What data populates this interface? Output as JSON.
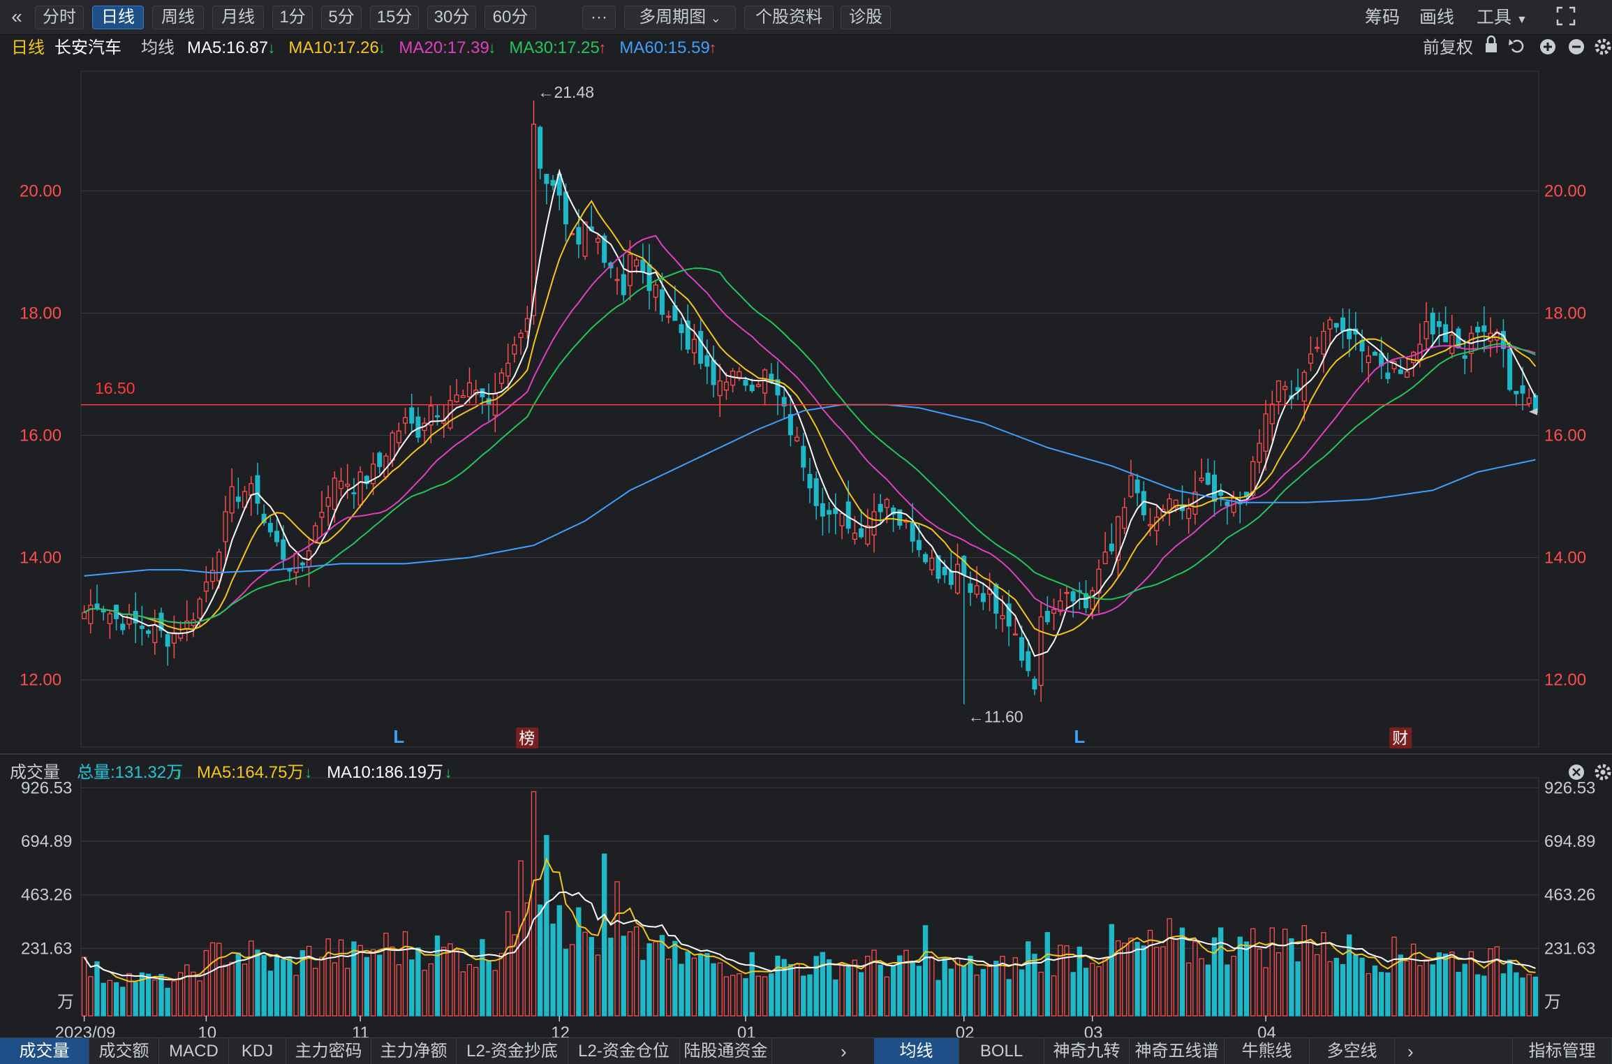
{
  "toolbar": {
    "back_icon": "double-chevron-left-icon",
    "periods": [
      "分时",
      "日线",
      "周线",
      "月线",
      "1分",
      "5分",
      "15分",
      "30分",
      "60分"
    ],
    "active_period": "日线",
    "more_label": "···",
    "multi_period": "多周期图",
    "stock_info": "个股资料",
    "diagnose": "诊股",
    "right_items": [
      "筹码",
      "画线",
      "工具"
    ],
    "fullscreen_icon": "fullscreen-icon"
  },
  "price_header": {
    "period": "日线",
    "stock_name": "长安汽车",
    "ma_label": "均线",
    "indicators": [
      {
        "text": "MA5:16.87",
        "color": "#ffffff",
        "arrow": "down"
      },
      {
        "text": "MA10:17.26",
        "color": "#f5c518",
        "arrow": "down"
      },
      {
        "text": "MA20:17.39",
        "color": "#e040c0",
        "arrow": "down"
      },
      {
        "text": "MA30:17.25",
        "color": "#22c55e",
        "arrow": "up"
      },
      {
        "text": "MA60:15.59",
        "color": "#3ea0ff",
        "arrow": "up"
      }
    ],
    "adjust": "前复权",
    "icons": [
      "lock-icon",
      "undo-icon",
      "zoom-in-icon",
      "zoom-out-icon",
      "settings-icon"
    ]
  },
  "volume_header": {
    "label": "成交量",
    "indicators": [
      {
        "text": "总量:131.32万",
        "color": "#22c5d5",
        "arrow": "down"
      },
      {
        "text": "MA5:164.75万",
        "color": "#f5c518",
        "arrow": "down"
      },
      {
        "text": "MA10:186.19万",
        "color": "#ffffff",
        "arrow": "down"
      }
    ],
    "icons": [
      "close-icon",
      "settings-icon"
    ]
  },
  "colors": {
    "up": "#ff4d4d",
    "down": "#1fb8c9",
    "ma5": "#ffffff",
    "ma10": "#f5c518",
    "ma20": "#e040c0",
    "ma30": "#22c55e",
    "ma60": "#3ea0ff",
    "ref_line": "#ff3b3b",
    "axis_text": "#ff4d4d",
    "grid": "#3a3d43"
  },
  "chart_data": [
    {
      "type": "candlestick",
      "title": "长安汽车 日线",
      "ylim": [
        10.9,
        22.3
      ],
      "y_ticks": [
        "12.00",
        "14.00",
        "16.00",
        "18.00",
        "20.00"
      ],
      "ref_line": {
        "value": 16.5,
        "label": "16.50"
      },
      "annotations": [
        {
          "label": "←21.48",
          "index": 70,
          "value": 21.48
        },
        {
          "label": "←11.60",
          "index": 137,
          "value": 11.6
        }
      ],
      "markers": [
        {
          "label": "L",
          "index": 49,
          "boxed": false
        },
        {
          "label": "榜",
          "index": 69,
          "boxed": true
        },
        {
          "label": "L",
          "index": 155,
          "boxed": false
        },
        {
          "label": "财",
          "index": 205,
          "boxed": true
        }
      ],
      "anchors": {
        "close": [
          [
            0,
            13.1
          ],
          [
            2,
            13.3
          ],
          [
            5,
            13.0
          ],
          [
            8,
            12.9
          ],
          [
            11,
            12.8
          ],
          [
            13,
            12.7
          ],
          [
            15,
            12.85
          ],
          [
            16,
            12.9
          ],
          [
            18,
            13.3
          ],
          [
            20,
            13.9
          ],
          [
            22,
            14.6
          ],
          [
            23,
            15.0
          ],
          [
            25,
            15.1
          ],
          [
            27,
            15.0
          ],
          [
            28,
            14.6
          ],
          [
            30,
            14.2
          ],
          [
            32,
            13.9
          ],
          [
            34,
            13.9
          ],
          [
            36,
            14.5
          ],
          [
            38,
            15.1
          ],
          [
            40,
            15.3
          ],
          [
            42,
            15.2
          ],
          [
            44,
            15.3
          ],
          [
            46,
            15.5
          ],
          [
            48,
            16.0
          ],
          [
            50,
            16.2
          ],
          [
            52,
            16.1
          ],
          [
            54,
            16.5
          ],
          [
            56,
            16.4
          ],
          [
            57,
            16.6
          ],
          [
            59,
            16.6
          ],
          [
            61,
            16.8
          ],
          [
            63,
            16.5
          ],
          [
            65,
            16.9
          ],
          [
            67,
            17.5
          ],
          [
            69,
            18.0
          ],
          [
            70,
            21.0
          ],
          [
            71,
            20.5
          ],
          [
            72,
            20.2
          ],
          [
            74,
            19.8
          ],
          [
            75,
            19.3
          ],
          [
            77,
            19.0
          ],
          [
            78,
            19.4
          ],
          [
            80,
            19.2
          ],
          [
            82,
            18.8
          ],
          [
            84,
            18.4
          ],
          [
            85,
            19.0
          ],
          [
            87,
            18.6
          ],
          [
            89,
            18.3
          ],
          [
            91,
            18.0
          ],
          [
            93,
            17.7
          ],
          [
            95,
            17.4
          ],
          [
            97,
            17.0
          ],
          [
            98,
            16.8
          ],
          [
            100,
            17.0
          ],
          [
            102,
            16.9
          ],
          [
            104,
            16.9
          ],
          [
            106,
            17.0
          ],
          [
            108,
            16.6
          ],
          [
            110,
            16.1
          ],
          [
            112,
            15.6
          ],
          [
            114,
            15.0
          ],
          [
            116,
            14.7
          ],
          [
            117,
            14.6
          ],
          [
            119,
            14.6
          ],
          [
            120,
            14.4
          ],
          [
            122,
            14.6
          ],
          [
            124,
            14.9
          ],
          [
            125,
            15.0
          ],
          [
            127,
            14.6
          ],
          [
            129,
            14.4
          ],
          [
            131,
            14.1
          ],
          [
            133,
            13.8
          ],
          [
            135,
            13.7
          ],
          [
            136,
            13.9
          ],
          [
            138,
            13.6
          ],
          [
            140,
            13.3
          ],
          [
            141,
            13.4
          ],
          [
            143,
            12.9
          ],
          [
            145,
            12.7
          ],
          [
            146,
            12.4
          ],
          [
            147,
            12.2
          ],
          [
            148,
            12.0
          ],
          [
            149,
            12.9
          ],
          [
            151,
            13.3
          ],
          [
            153,
            13.5
          ],
          [
            155,
            13.4
          ],
          [
            156,
            13.2
          ],
          [
            158,
            13.8
          ],
          [
            160,
            14.1
          ],
          [
            161,
            14.7
          ],
          [
            163,
            15.2
          ],
          [
            164,
            15.0
          ],
          [
            166,
            14.4
          ],
          [
            168,
            14.8
          ],
          [
            170,
            14.8
          ],
          [
            172,
            14.8
          ],
          [
            174,
            15.2
          ],
          [
            176,
            14.9
          ],
          [
            178,
            14.8
          ],
          [
            180,
            14.9
          ],
          [
            182,
            15.4
          ],
          [
            184,
            16.3
          ],
          [
            186,
            16.8
          ],
          [
            188,
            16.6
          ],
          [
            190,
            16.9
          ],
          [
            192,
            17.6
          ],
          [
            194,
            17.9
          ],
          [
            195,
            17.6
          ],
          [
            197,
            17.7
          ],
          [
            199,
            17.5
          ],
          [
            201,
            17.3
          ],
          [
            203,
            17.1
          ],
          [
            205,
            17.0
          ],
          [
            207,
            17.4
          ],
          [
            209,
            17.8
          ],
          [
            211,
            17.7
          ],
          [
            213,
            17.5
          ],
          [
            215,
            17.3
          ],
          [
            217,
            17.8
          ],
          [
            219,
            17.7
          ],
          [
            221,
            17.4
          ],
          [
            222,
            16.9
          ],
          [
            224,
            16.7
          ],
          [
            225,
            16.7
          ],
          [
            226,
            16.4
          ]
        ],
        "ma60": [
          [
            0,
            13.7
          ],
          [
            10,
            13.8
          ],
          [
            15,
            13.8
          ],
          [
            20,
            13.75
          ],
          [
            30,
            13.8
          ],
          [
            40,
            13.9
          ],
          [
            50,
            13.9
          ],
          [
            55,
            13.95
          ],
          [
            60,
            14.0
          ],
          [
            70,
            14.2
          ],
          [
            78,
            14.6
          ],
          [
            85,
            15.1
          ],
          [
            95,
            15.6
          ],
          [
            105,
            16.1
          ],
          [
            112,
            16.4
          ],
          [
            118,
            16.5
          ],
          [
            125,
            16.5
          ],
          [
            130,
            16.45
          ],
          [
            140,
            16.2
          ],
          [
            150,
            15.8
          ],
          [
            160,
            15.5
          ],
          [
            170,
            15.1
          ],
          [
            180,
            14.9
          ],
          [
            190,
            14.9
          ],
          [
            200,
            14.95
          ],
          [
            210,
            15.1
          ],
          [
            217,
            15.4
          ],
          [
            226,
            15.6
          ]
        ]
      },
      "volume_anchors": [
        [
          0,
          160
        ],
        [
          3,
          120
        ],
        [
          8,
          110
        ],
        [
          12,
          90
        ],
        [
          15,
          100
        ],
        [
          18,
          160
        ],
        [
          20,
          200
        ],
        [
          22,
          240
        ],
        [
          24,
          220
        ],
        [
          26,
          210
        ],
        [
          28,
          190
        ],
        [
          30,
          170
        ],
        [
          32,
          170
        ],
        [
          34,
          190
        ],
        [
          36,
          220
        ],
        [
          38,
          230
        ],
        [
          40,
          210
        ],
        [
          42,
          200
        ],
        [
          44,
          220
        ],
        [
          46,
          240
        ],
        [
          48,
          250
        ],
        [
          50,
          240
        ],
        [
          52,
          250
        ],
        [
          54,
          240
        ],
        [
          56,
          230
        ],
        [
          58,
          220
        ],
        [
          60,
          210
        ],
        [
          62,
          220
        ],
        [
          64,
          240
        ],
        [
          66,
          270
        ],
        [
          68,
          330
        ],
        [
          69,
          550
        ],
        [
          70,
          780
        ],
        [
          71,
          620
        ],
        [
          72,
          560
        ],
        [
          73,
          480
        ],
        [
          74,
          520
        ],
        [
          75,
          380
        ],
        [
          77,
          330
        ],
        [
          79,
          290
        ],
        [
          81,
          280
        ],
        [
          83,
          260
        ],
        [
          85,
          250
        ],
        [
          87,
          240
        ],
        [
          89,
          230
        ],
        [
          91,
          200
        ],
        [
          93,
          200
        ],
        [
          95,
          190
        ],
        [
          97,
          180
        ],
        [
          99,
          175
        ],
        [
          101,
          180
        ],
        [
          103,
          170
        ],
        [
          106,
          170
        ],
        [
          109,
          170
        ],
        [
          112,
          170
        ],
        [
          115,
          165
        ],
        [
          118,
          175
        ],
        [
          121,
          180
        ],
        [
          124,
          170
        ],
        [
          127,
          170
        ],
        [
          130,
          165
        ],
        [
          133,
          165
        ],
        [
          136,
          160
        ],
        [
          139,
          155
        ],
        [
          142,
          150
        ],
        [
          145,
          160
        ],
        [
          148,
          180
        ],
        [
          151,
          200
        ],
        [
          154,
          220
        ],
        [
          157,
          230
        ],
        [
          160,
          250
        ],
        [
          163,
          240
        ],
        [
          166,
          240
        ],
        [
          169,
          240
        ],
        [
          172,
          240
        ],
        [
          175,
          250
        ],
        [
          178,
          250
        ],
        [
          181,
          250
        ],
        [
          184,
          260
        ],
        [
          187,
          270
        ],
        [
          190,
          260
        ],
        [
          193,
          250
        ],
        [
          196,
          240
        ],
        [
          199,
          220
        ],
        [
          202,
          220
        ],
        [
          205,
          210
        ],
        [
          208,
          210
        ],
        [
          211,
          200
        ],
        [
          214,
          200
        ],
        [
          217,
          190
        ],
        [
          220,
          180
        ],
        [
          223,
          180
        ],
        [
          226,
          160
        ]
      ],
      "volume_spikes": [
        [
          66,
          390
        ],
        [
          68,
          610
        ],
        [
          70,
          910
        ],
        [
          72,
          720
        ],
        [
          81,
          640
        ],
        [
          83,
          520
        ],
        [
          89,
          260
        ],
        [
          131,
          330
        ],
        [
          147,
          260
        ],
        [
          150,
          300
        ],
        [
          169,
          360
        ],
        [
          177,
          320
        ],
        [
          180,
          280
        ],
        [
          190,
          330
        ],
        [
          193,
          300
        ],
        [
          204,
          280
        ],
        [
          207,
          250
        ]
      ],
      "volume_ylim": [
        0,
        970
      ],
      "volume_ticks": [
        "231.63",
        "463.26",
        "694.89",
        "926.53"
      ],
      "volume_unit": "万",
      "x_labels": [
        {
          "label": "2023/09",
          "index": 0
        },
        {
          "label": "10",
          "index": 19
        },
        {
          "label": "11",
          "index": 43
        },
        {
          "label": "12",
          "index": 74
        },
        {
          "label": "01",
          "index": 103
        },
        {
          "label": "02",
          "index": 137
        },
        {
          "label": "03",
          "index": 157
        },
        {
          "label": "04",
          "index": 184
        }
      ],
      "count": 227
    }
  ],
  "bottom_tabs": {
    "left": [
      "成交量",
      "成交额",
      "MACD",
      "KDJ",
      "主力密码",
      "主力净额",
      "L2-资金抄底",
      "L2-资金仓位",
      "陆股通资金"
    ],
    "left_active": "成交量",
    "right": [
      "均线",
      "BOLL",
      "神奇九转",
      "神奇五线谱",
      "牛熊线",
      "多空线"
    ],
    "right_active": "均线",
    "indicator_manage": "指标管理",
    "arrow": "›"
  }
}
